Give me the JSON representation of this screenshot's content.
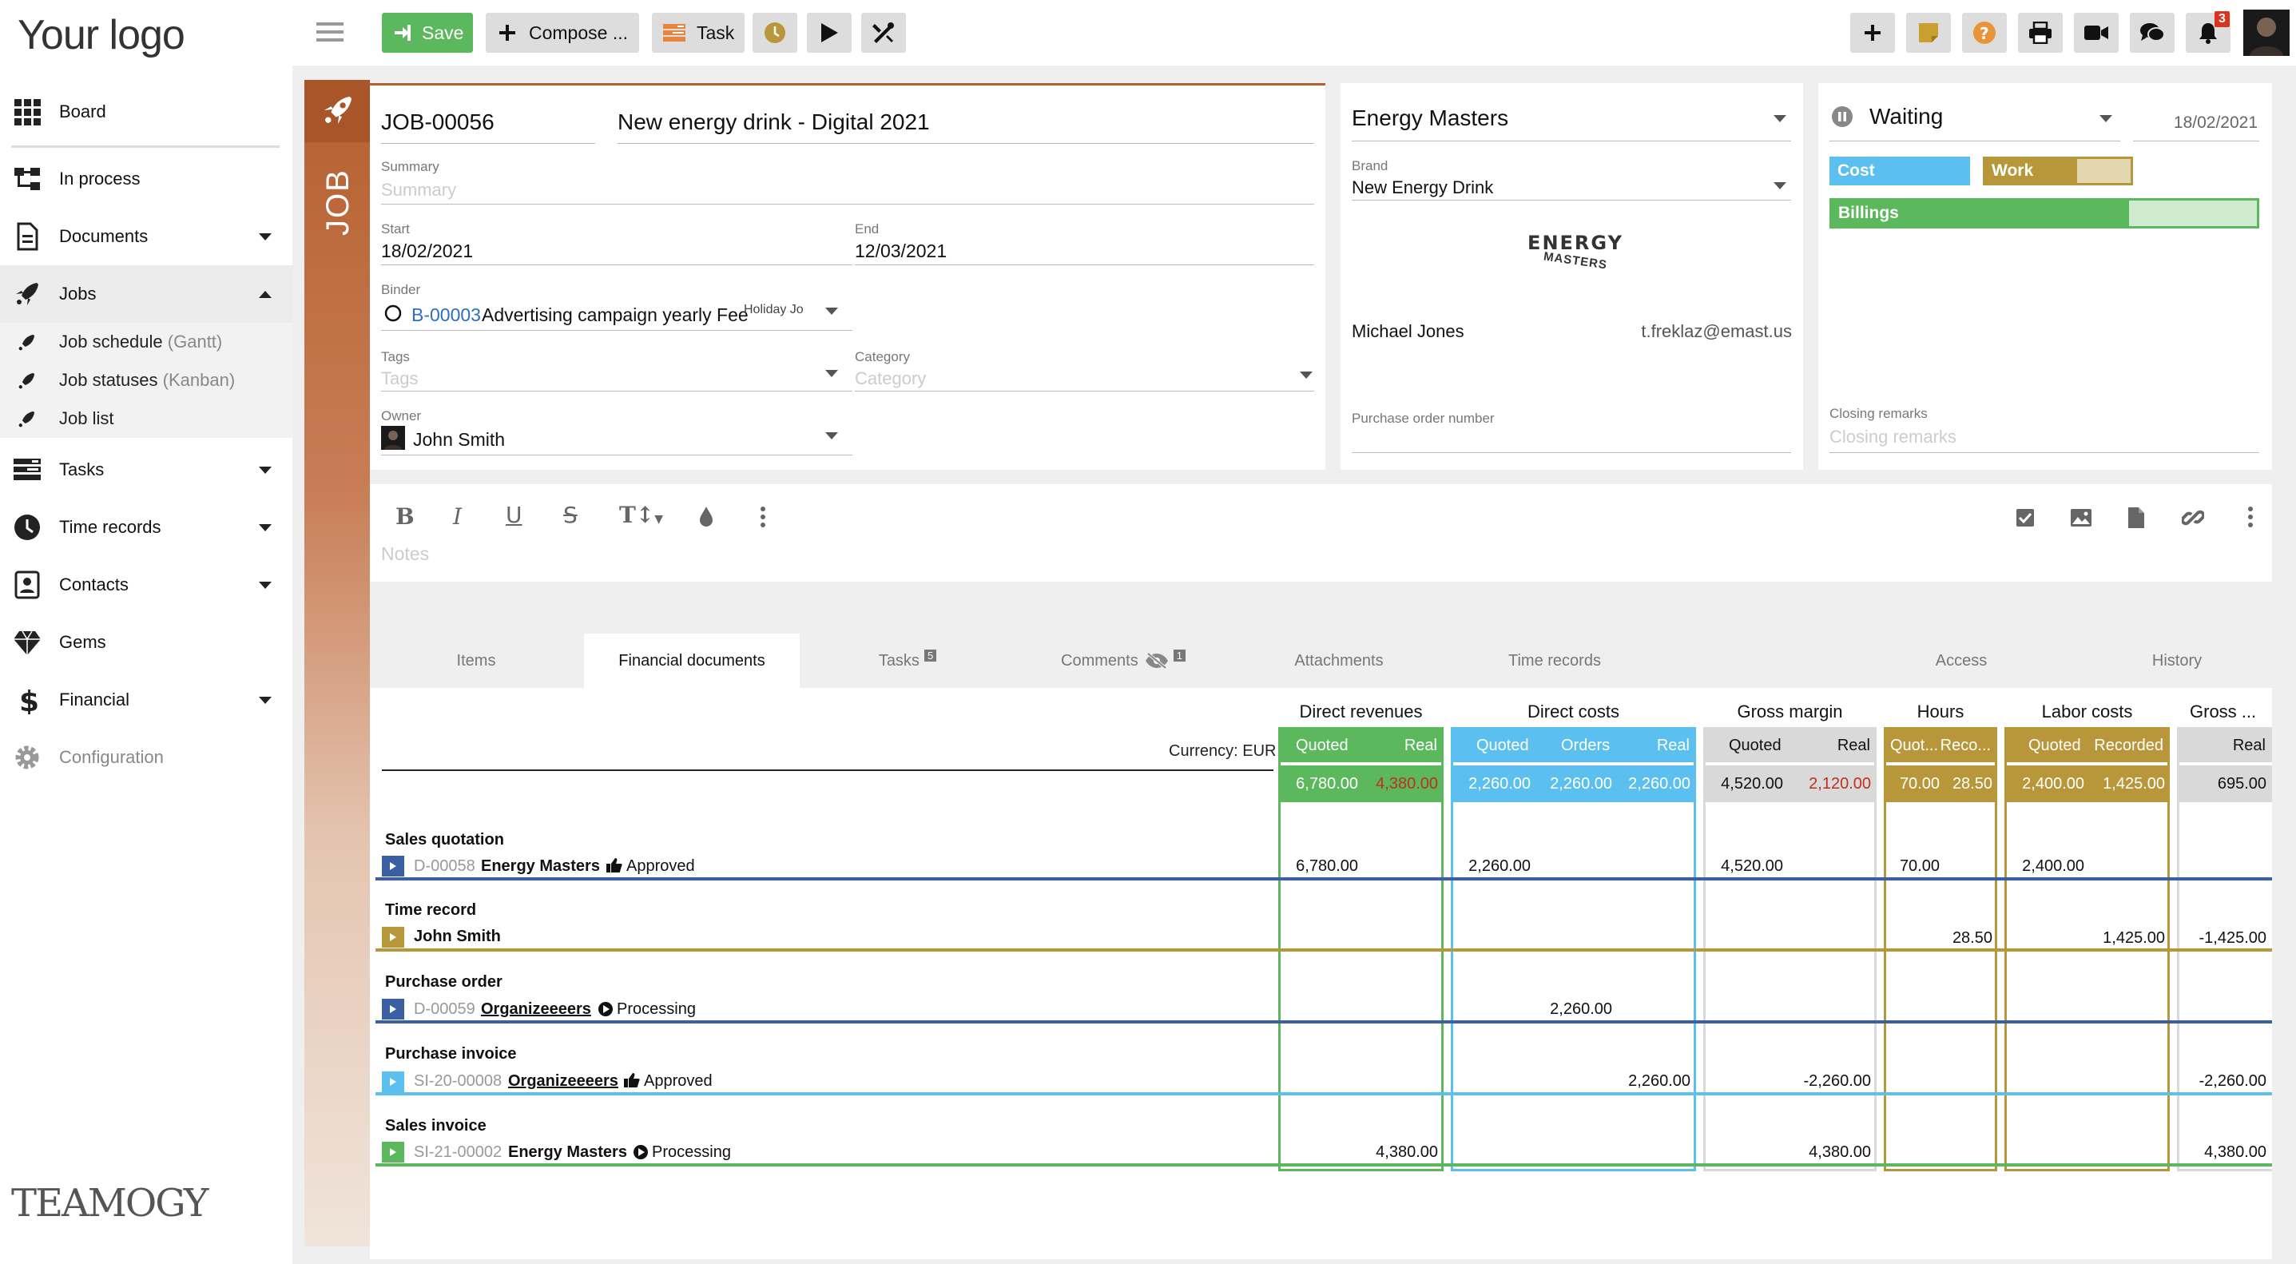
{
  "brand": {
    "logo_text": "Your logo",
    "footer_logo": "TEAMOGY"
  },
  "sidebar": {
    "items": [
      {
        "label": "Board",
        "icon": "grid-icon"
      },
      {
        "label": "In process",
        "icon": "workflow-icon"
      },
      {
        "label": "Documents",
        "icon": "document-icon"
      },
      {
        "label": "Jobs",
        "icon": "rocket-icon"
      },
      {
        "label": "Tasks",
        "icon": "tasks-icon"
      },
      {
        "label": "Time records",
        "icon": "clock-icon"
      },
      {
        "label": "Contacts",
        "icon": "contacts-icon"
      },
      {
        "label": "Gems",
        "icon": "gem-icon"
      },
      {
        "label": "Financial",
        "icon": "dollar-icon"
      },
      {
        "label": "Configuration",
        "icon": "gear-icon"
      }
    ],
    "jobs_sub": [
      {
        "label": "Job schedule",
        "hint": "(Gantt)"
      },
      {
        "label": "Job statuses",
        "hint": "(Kanban)"
      },
      {
        "label": "Job list",
        "hint": ""
      }
    ]
  },
  "toolbar": {
    "save": "Save",
    "compose": "Compose ...",
    "task": "Task",
    "notification_count": "3"
  },
  "job": {
    "side_label": "JOB",
    "number": "JOB-00056",
    "title": "New energy drink - Digital 2021",
    "summary_label": "Summary",
    "summary_placeholder": "Summary",
    "start_label": "Start",
    "start": "18/02/2021",
    "end_label": "End",
    "end": "12/03/2021",
    "binder_label": "Binder",
    "binder_id": "B-00003",
    "binder_name": "Advertising campaign yearly Fee",
    "binder_extra": "Holiday Jo",
    "tags_label": "Tags",
    "tags_placeholder": "Tags",
    "category_label": "Category",
    "category_placeholder": "Category",
    "owner_label": "Owner",
    "owner": "John Smith"
  },
  "client": {
    "name": "Energy Masters",
    "brand_label": "Brand",
    "brand": "New Energy Drink",
    "logo_line1": "ENERGY",
    "logo_line2": "MASTERS",
    "contact_name": "Michael Jones",
    "contact_email": "t.freklaz@emast.us",
    "po_label": "Purchase order number"
  },
  "status": {
    "label": "Waiting",
    "date": "18/02/2021",
    "cost": "Cost",
    "work": "Work",
    "billings": "Billings",
    "billings_progress": 0.7,
    "closing_label": "Closing remarks",
    "closing_placeholder": "Closing remarks"
  },
  "editor": {
    "notes_placeholder": "Notes"
  },
  "tabs": [
    {
      "label": "Items",
      "badge": ""
    },
    {
      "label": "Financial documents",
      "badge": ""
    },
    {
      "label": "Tasks",
      "badge": "5"
    },
    {
      "label": "Comments",
      "badge": "1"
    },
    {
      "label": "Attachments",
      "badge": ""
    },
    {
      "label": "Time records",
      "badge": ""
    },
    {
      "label": "Access",
      "badge": ""
    },
    {
      "label": "History",
      "badge": ""
    }
  ],
  "fin": {
    "currency": "Currency: EUR",
    "groups": {
      "direct_revenues": "Direct revenues",
      "direct_costs": "Direct costs",
      "gross_margin": "Gross margin",
      "hours": "Hours",
      "labor_costs": "Labor costs",
      "gross2": "Gross ..."
    },
    "subheaders": {
      "dr_quoted": "Quoted",
      "dr_real": "Real",
      "dc_quoted": "Quoted",
      "dc_orders": "Orders",
      "dc_real": "Real",
      "gm_quoted": "Quoted",
      "gm_real": "Real",
      "h_quoted": "Quot...",
      "h_recorded": "Reco...",
      "lc_quoted": "Quoted",
      "lc_recorded": "Recorded",
      "g2_real": "Real"
    },
    "totals": {
      "dr_quoted": "6,780.00",
      "dr_real": "4,380.00",
      "dc_quoted": "2,260.00",
      "dc_orders": "2,260.00",
      "dc_real": "2,260.00",
      "gm_quoted": "4,520.00",
      "gm_real": "2,120.00",
      "h_quoted": "70.00",
      "h_recorded": "28.50",
      "lc_quoted": "2,400.00",
      "lc_recorded": "1,425.00",
      "g2_real": "695.00"
    },
    "rows": [
      {
        "type": "Sales quotation",
        "id": "D-00058",
        "name": "Energy Masters",
        "status": "Approved",
        "dr_quoted": "6,780.00",
        "dc_quoted": "2,260.00",
        "gm_quoted": "4,520.00",
        "h_quoted": "70.00",
        "lc_quoted": "2,400.00"
      },
      {
        "type": "Time record",
        "id": "",
        "name": "John Smith",
        "status": "",
        "h_recorded": "28.50",
        "lc_recorded": "1,425.00",
        "g2_real": "-1,425.00"
      },
      {
        "type": "Purchase order",
        "id": "D-00059",
        "name": "Organizeeeers",
        "status": "Processing",
        "dc_orders": "2,260.00"
      },
      {
        "type": "Purchase invoice",
        "id": "SI-20-00008",
        "name": "Organizeeeers",
        "status": "Approved",
        "dc_real": "2,260.00",
        "gm_real": "-2,260.00",
        "g2_real": "-2,260.00"
      },
      {
        "type": "Sales invoice",
        "id": "SI-21-00002",
        "name": "Energy Masters",
        "status": "Processing",
        "dr_real": "4,380.00",
        "gm_real": "4,380.00",
        "g2_real": "4,380.00"
      }
    ]
  },
  "colors": {
    "green": "#5cb85c",
    "blue": "#5bc0f0",
    "gold": "#b8973a",
    "grey": "#d9d9d9",
    "job_orange": "#b5602f",
    "red": "#d9341f",
    "dark_blue": "#3b5fa3"
  }
}
